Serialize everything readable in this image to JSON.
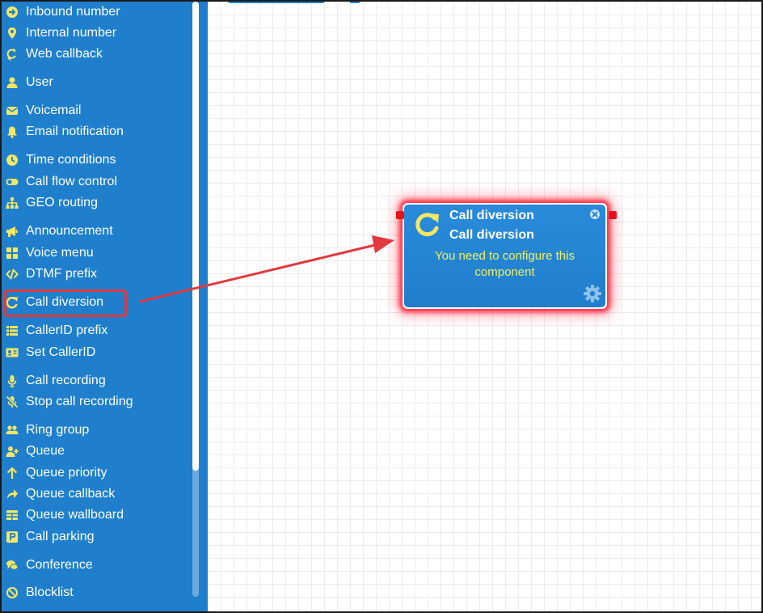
{
  "sidebar": {
    "items": [
      {
        "label": "Inbound number",
        "icon": "arrow-circle-icon"
      },
      {
        "label": "Internal number",
        "icon": "map-pin-icon"
      },
      {
        "label": "Web callback",
        "icon": "callback-icon"
      },
      {
        "label": "User",
        "icon": "user-icon"
      },
      {
        "label": "Voicemail",
        "icon": "envelope-icon"
      },
      {
        "label": "Email notification",
        "icon": "bell-icon"
      },
      {
        "label": "Time conditions",
        "icon": "clock-icon"
      },
      {
        "label": "Call flow control",
        "icon": "toggle-icon"
      },
      {
        "label": "GEO routing",
        "icon": "sitemap-icon"
      },
      {
        "label": "Announcement",
        "icon": "megaphone-icon"
      },
      {
        "label": "Voice menu",
        "icon": "grid-icon"
      },
      {
        "label": "DTMF prefix",
        "icon": "code-icon"
      },
      {
        "label": "Call diversion",
        "icon": "redo-icon"
      },
      {
        "label": "CallerID prefix",
        "icon": "list-icon"
      },
      {
        "label": "Set CallerID",
        "icon": "id-card-icon"
      },
      {
        "label": "Call recording",
        "icon": "microphone-icon"
      },
      {
        "label": "Stop call recording",
        "icon": "microphone-slash-icon"
      },
      {
        "label": "Ring group",
        "icon": "users-icon"
      },
      {
        "label": "Queue",
        "icon": "user-plus-icon"
      },
      {
        "label": "Queue priority",
        "icon": "arrow-up-icon"
      },
      {
        "label": "Queue callback",
        "icon": "share-icon"
      },
      {
        "label": "Queue wallboard",
        "icon": "table-icon"
      },
      {
        "label": "Call parking",
        "icon": "parking-icon"
      },
      {
        "label": "Conference",
        "icon": "comments-icon"
      },
      {
        "label": "Blocklist",
        "icon": "ban-icon"
      }
    ]
  },
  "node": {
    "title": "Call diversion",
    "subtitle": "Call diversion",
    "message": "You need to configure this component",
    "icon": "redo-icon",
    "close_icon": "close-circle-icon",
    "settings_icon": "gear-icon"
  },
  "colors": {
    "sidebar_bg": "#1f7fcd",
    "highlight": "#e2393f",
    "node_message": "#f2f25b",
    "node_icon": "#f5e663",
    "port": "#e8101c"
  }
}
